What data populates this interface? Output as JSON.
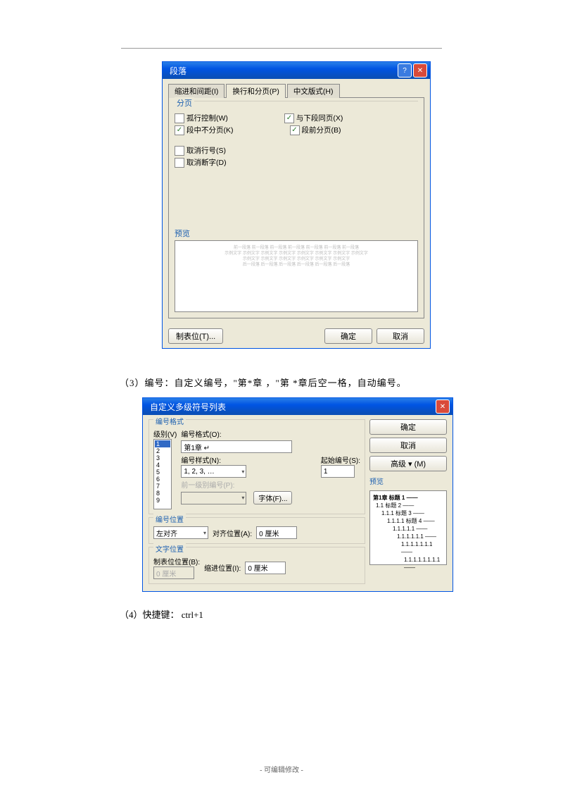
{
  "dialog1": {
    "title": "段落",
    "tabs": [
      "缩进和间距(I)",
      "换行和分页(P)",
      "中文版式(H)"
    ],
    "group_page": "分页",
    "cb": {
      "orphan": "孤行控制(W)",
      "orphan_checked": false,
      "keepnext": "与下段同页(X)",
      "keepnext_checked": true,
      "keeptogether": "段中不分页(K)",
      "keeptogether_checked": true,
      "pagebreak": "段前分页(B)",
      "pagebreak_checked": true,
      "noline": "取消行号(S)",
      "noline_checked": false,
      "nohyph": "取消断字(D)",
      "nohyph_checked": false
    },
    "preview_label": "预览",
    "tabstops": "制表位(T)...",
    "ok": "确定",
    "cancel": "取消"
  },
  "text3": "（3）编号：自定义编号，\"第*章 ，\"第 *章后空一格，自动编号。",
  "dialog2": {
    "title": "自定义多级符号列表",
    "group_format": "编号格式",
    "level_label": "级别(V)",
    "levels": [
      "1",
      "2",
      "3",
      "4",
      "5",
      "6",
      "7",
      "8",
      "9"
    ],
    "fmt_label": "编号格式(O):",
    "fmt_value": "第1章 ↵",
    "style_label": "编号样式(N):",
    "style_value": "1, 2, 3, …",
    "start_label": "起始编号(S):",
    "start_value": "1",
    "prev_label": "前一级别编号(P):",
    "font_btn": "字体(F)...",
    "group_numpos": "编号位置",
    "align_value": "左对齐",
    "alignpos_label": "对齐位置(A):",
    "alignpos_value": "0 厘米",
    "group_textpos": "文字位置",
    "tabpos_label": "制表位位置(B):",
    "tabpos_value": "0 厘米",
    "indentpos_label": "缩进位置(I):",
    "indentpos_value": "0 厘米",
    "ok": "确定",
    "cancel": "取消",
    "advanced": "高级 ▾ (M)",
    "preview_label": "预览",
    "preview_items": [
      "第1章 标题 1 ——",
      "1.1 标题 2 ——",
      "1.1.1 标题 3 ——",
      "1.1.1.1 标题 4 ——",
      "1.1.1.1.1 ——",
      "1.1.1.1.1.1 ——",
      "1.1.1.1.1.1.1 ——",
      "1.1.1.1.1.1.1.1 ——",
      "1.1.1.1.1.1.1.1.1 ——"
    ]
  },
  "text4": "（4）快捷键： ctrl+1",
  "footer": "- 可编辑修改 -"
}
